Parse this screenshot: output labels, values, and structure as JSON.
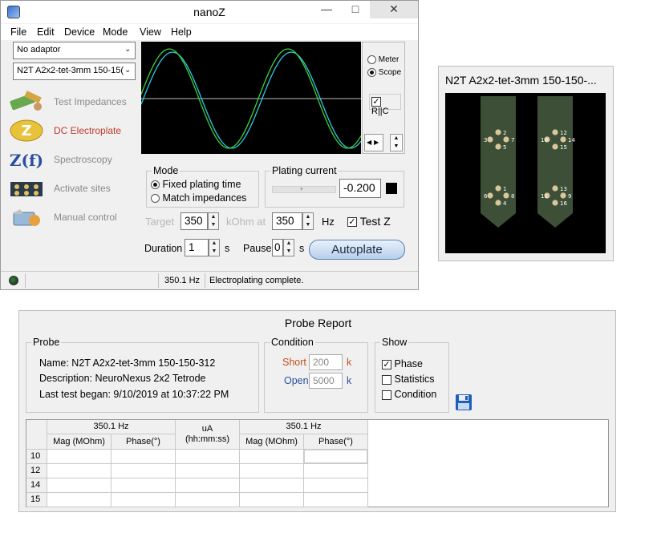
{
  "main_window": {
    "title": "nanoZ",
    "menu": [
      "File",
      "Edit",
      "Device",
      "Mode",
      "View",
      "Help"
    ],
    "adaptor_select": "No adaptor",
    "probe_select": "N2T A2x2-tet-3mm 150-15(",
    "sidebar": [
      {
        "label": "Test Impedances",
        "icon": "probe-test-icon"
      },
      {
        "label": "DC Electroplate",
        "icon": "electroplate-z-icon",
        "active": true
      },
      {
        "label": "Spectroscopy",
        "icon": "zf-spectroscopy-icon"
      },
      {
        "label": "Activate sites",
        "icon": "activate-sites-icon"
      },
      {
        "label": "Manual control",
        "icon": "manual-control-icon"
      }
    ],
    "scope_panel": {
      "meter_label": "Meter",
      "scope_label": "Scope",
      "selected": "Scope",
      "ric_label": "R||C",
      "ric_checked": true
    },
    "mode_group": {
      "title": "Mode",
      "options": [
        "Fixed plating time",
        "Match impedances"
      ],
      "selected": "Fixed plating time"
    },
    "plating_current": {
      "title": "Plating current",
      "value": "-0.200"
    },
    "target": {
      "label": "Target",
      "value": "350",
      "unit_label": "kOhm at",
      "freq_value": "350",
      "freq_unit": "Hz",
      "test_z_label": "Test Z",
      "test_z_checked": true
    },
    "duration": {
      "label": "Duration",
      "value": "1",
      "unit": "s",
      "pause_label": "Pause",
      "pause_value": "0",
      "pause_unit": "s"
    },
    "autoplate_label": "Autoplate",
    "status": {
      "frequency": "350.1 Hz",
      "message": "Electroplating complete."
    },
    "colors": {
      "scope_trace_1": "#3cd23c",
      "scope_trace_2": "#2ec9e0",
      "active_label": "#c0392b"
    }
  },
  "probe_window": {
    "title": "N2T A2x2-tet-3mm 150-150-...",
    "shank1_sites": [
      "2",
      "3",
      "7",
      "5",
      "1",
      "6",
      "8",
      "4"
    ],
    "shank2_sites": [
      "12",
      "10",
      "14",
      "15",
      "13",
      "11",
      "9",
      "16"
    ]
  },
  "report_window": {
    "title": "Probe Report",
    "probe_group": {
      "title": "Probe",
      "name": "Name: N2T A2x2-tet-3mm 150-150-312",
      "description": "Description: NeuroNexus 2x2 Tetrode",
      "last_test": "Last test began: 9/10/2019 at 10:37:22 PM"
    },
    "condition_group": {
      "title": "Condition",
      "short_label": "Short",
      "short_value": "200",
      "short_unit": "k",
      "open_label": "Open",
      "open_value": "5000",
      "open_unit": "k"
    },
    "show_group": {
      "title": "Show",
      "options": [
        {
          "label": "Phase",
          "checked": true
        },
        {
          "label": "Statistics",
          "checked": false
        },
        {
          "label": "Condition",
          "checked": false
        }
      ]
    },
    "table": {
      "group1_header": "350.1 Hz",
      "uA_header": "uA",
      "time_header": "(hh:mm:ss)",
      "group2_header": "350.1 Hz",
      "col_mag": "Mag (MOhm)",
      "col_phase": "Phase(°)",
      "rows": [
        "10",
        "12",
        "14",
        "15"
      ]
    }
  }
}
